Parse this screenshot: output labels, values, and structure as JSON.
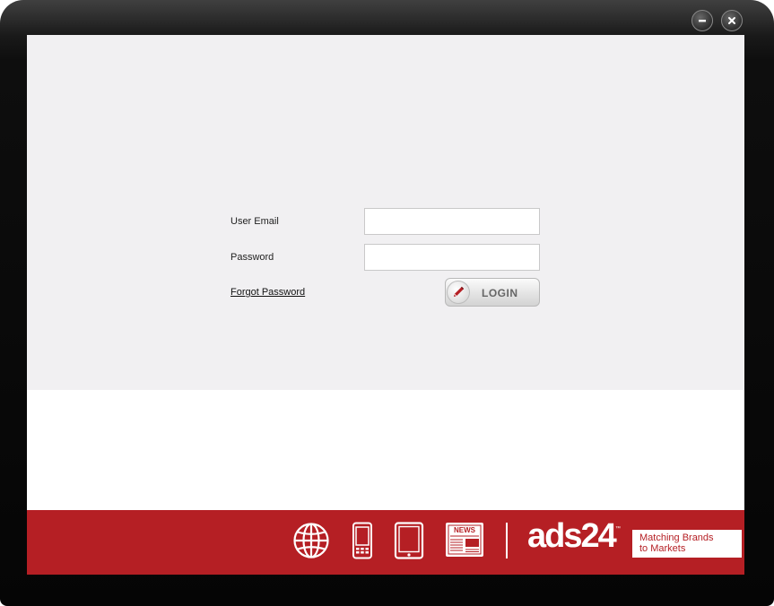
{
  "window": {
    "minimize_icon": "minus-icon",
    "close_icon": "close-icon"
  },
  "login": {
    "email_label": "User Email",
    "email_value": "",
    "password_label": "Password",
    "password_value": "",
    "forgot_label": "Forgot Password",
    "login_label": "LOGIN",
    "login_icon": "pen-icon"
  },
  "footer": {
    "icons": [
      "globe-icon",
      "phone-icon",
      "tablet-icon",
      "newspaper-icon"
    ],
    "news_badge": "NEWS",
    "logo": "ads24",
    "tm": "™",
    "tagline_line1": "Matching Brands",
    "tagline_line2": "to Markets"
  },
  "colors": {
    "brand_red": "#b51f24",
    "login_background": "#f1f0f2",
    "frame": "#050505"
  }
}
